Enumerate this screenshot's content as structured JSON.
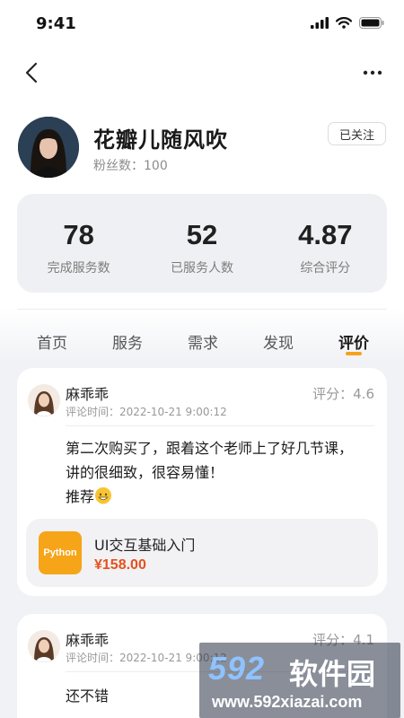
{
  "status": {
    "time": "9:41"
  },
  "nav": {
    "back_icon": "chevron-left-icon",
    "more_icon": "more-dots-icon"
  },
  "profile": {
    "name": "花瓣儿随风吹",
    "fans": "粉丝数：100",
    "follow_label": "已关注"
  },
  "stats": [
    {
      "value": "78",
      "label": "完成服务数"
    },
    {
      "value": "52",
      "label": "已服务人数"
    },
    {
      "value": "4.87",
      "label": "综合评分"
    }
  ],
  "tabs": [
    "首页",
    "服务",
    "需求",
    "发现",
    "评价"
  ],
  "active_tab": "评价",
  "reviews": [
    {
      "name": "麻乖乖",
      "time": "评论时间：2022-10-21 9:00:12",
      "score": "评分：4.6",
      "text_line1": "第二次购买了，跟着这个老师上了好几节课，",
      "text_line2": "讲的很细致，很容易懂！",
      "text_line3": "推荐",
      "product": {
        "thumb_label": "Python",
        "title": "UI交互基础入门",
        "price": "¥158.00"
      }
    },
    {
      "name": "麻乖乖",
      "time": "评论时间：2022-10-21 9:00:12",
      "score": "评分：4.1",
      "text": "还不错"
    }
  ],
  "watermark": {
    "big": "592",
    "cn": "软件园",
    "url": "www.592xiazai.com"
  },
  "colors": {
    "accent": "#f5a21b",
    "price": "#e8501c",
    "stats_bg": "#eff0f3"
  }
}
